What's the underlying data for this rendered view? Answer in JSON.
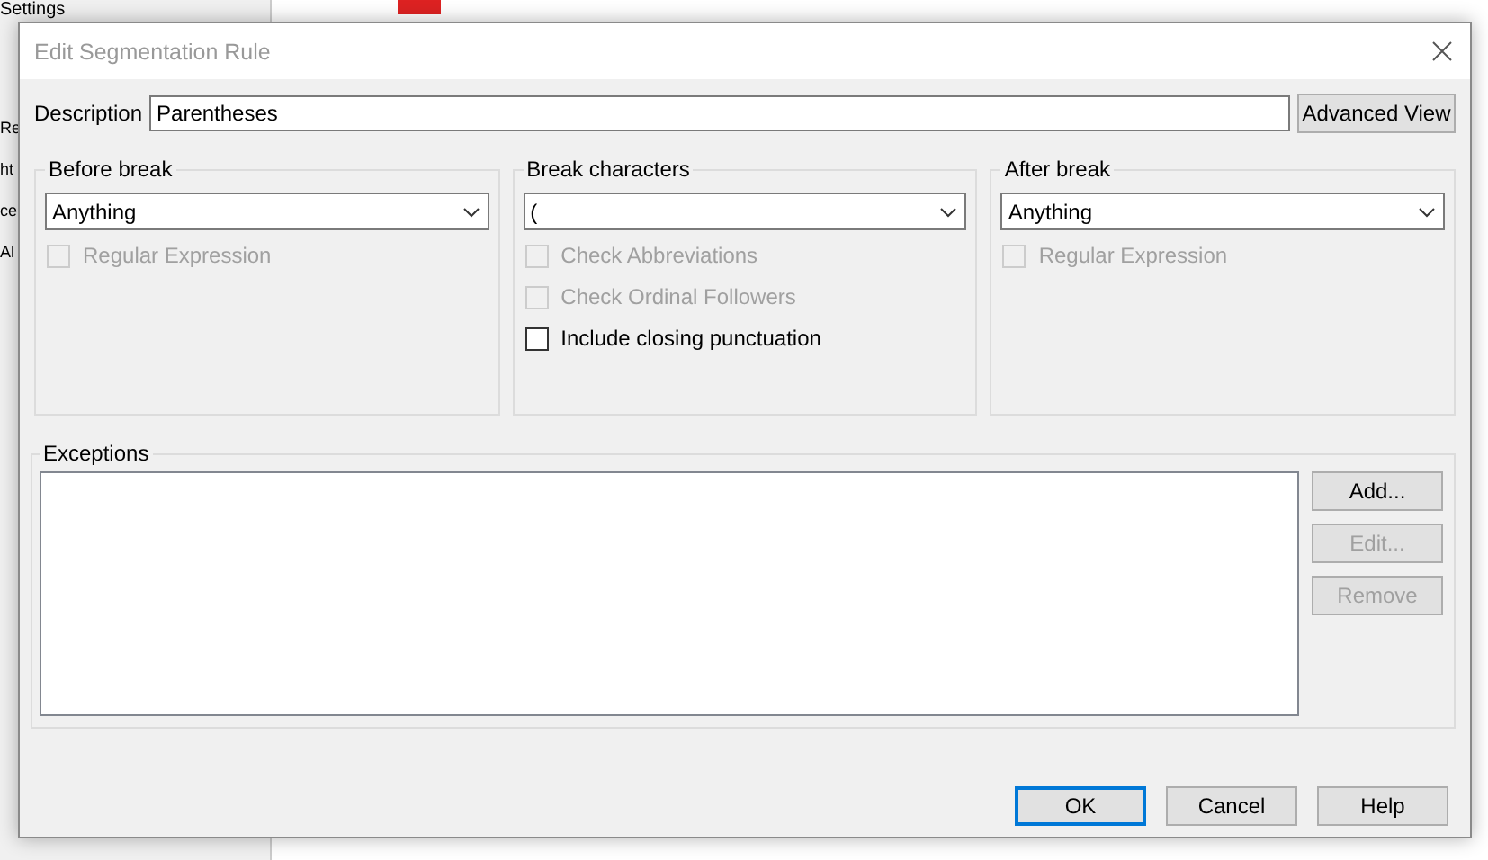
{
  "background": {
    "sidebar_items": [
      "Settings",
      "Re",
      "ht",
      "ce",
      "Al"
    ]
  },
  "window": {
    "title": "Edit Segmentation Rule"
  },
  "description": {
    "label": "Description",
    "value": "Parentheses",
    "button": "Advanced View"
  },
  "groups": [
    {
      "title": "Before break",
      "dropdown": "Anything",
      "options": [
        {
          "label": "Regular Expression",
          "checked": false,
          "disabled": true
        }
      ]
    },
    {
      "title": "Break characters",
      "dropdown": "(",
      "options": [
        {
          "label": "Check Abbreviations",
          "checked": false,
          "disabled": true
        },
        {
          "label": "Check Ordinal Followers",
          "checked": false,
          "disabled": true
        },
        {
          "label": "Include closing punctuation",
          "checked": false,
          "disabled": false
        }
      ]
    },
    {
      "title": "After break",
      "dropdown": "Anything",
      "options": [
        {
          "label": "Regular Expression",
          "checked": false,
          "disabled": true
        }
      ]
    }
  ],
  "exceptions": {
    "title": "Exceptions",
    "buttons": [
      {
        "label": "Add...",
        "disabled": false
      },
      {
        "label": "Edit...",
        "disabled": true
      },
      {
        "label": "Remove",
        "disabled": true
      }
    ]
  },
  "buttons": [
    {
      "label": "OK",
      "default": true
    },
    {
      "label": "Cancel",
      "default": false
    },
    {
      "label": "Help",
      "default": false
    }
  ]
}
